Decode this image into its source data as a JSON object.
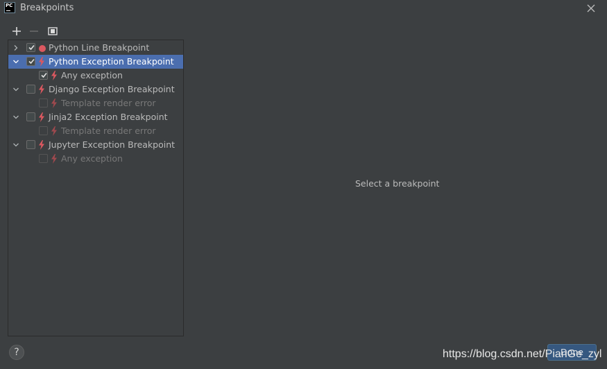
{
  "window": {
    "title": "Breakpoints",
    "logo_text": "PC"
  },
  "toolbar": {
    "add_label": "+",
    "remove_label": "−"
  },
  "tree": [
    {
      "label": "Python Line Breakpoint",
      "level": 0,
      "expanded": false,
      "checked": true,
      "icon": "red-dot-icon",
      "enabled": true,
      "selected": false
    },
    {
      "label": "Python Exception Breakpoint",
      "level": 0,
      "expanded": true,
      "checked": true,
      "icon": "lightning-icon",
      "enabled": true,
      "selected": true
    },
    {
      "label": "Any exception",
      "level": 1,
      "checked": true,
      "icon": "lightning-icon",
      "enabled": true,
      "selected": false
    },
    {
      "label": "Django Exception Breakpoint",
      "level": 0,
      "expanded": true,
      "checked": false,
      "icon": "lightning-icon",
      "enabled": true,
      "selected": false
    },
    {
      "label": "Template render error",
      "level": 1,
      "checked": false,
      "icon": "lightning-icon",
      "enabled": false,
      "selected": false
    },
    {
      "label": "Jinja2 Exception Breakpoint",
      "level": 0,
      "expanded": true,
      "checked": false,
      "icon": "lightning-icon",
      "enabled": true,
      "selected": false
    },
    {
      "label": "Template render error",
      "level": 1,
      "checked": false,
      "icon": "lightning-icon",
      "enabled": false,
      "selected": false
    },
    {
      "label": "Jupyter Exception Breakpoint",
      "level": 0,
      "expanded": true,
      "checked": false,
      "icon": "lightning-icon",
      "enabled": true,
      "selected": false
    },
    {
      "label": "Any exception",
      "level": 1,
      "checked": false,
      "icon": "lightning-icon",
      "enabled": false,
      "selected": false
    }
  ],
  "detail": {
    "empty_text": "Select a breakpoint"
  },
  "footer": {
    "help_label": "?",
    "done_label": "Done"
  },
  "watermark": "https://blog.csdn.net/PianGe_zyl",
  "colors": {
    "background": "#3c3f41",
    "selection": "#4b6eaf",
    "breakpoint_red": "#db5860",
    "primary_button": "#365880"
  }
}
